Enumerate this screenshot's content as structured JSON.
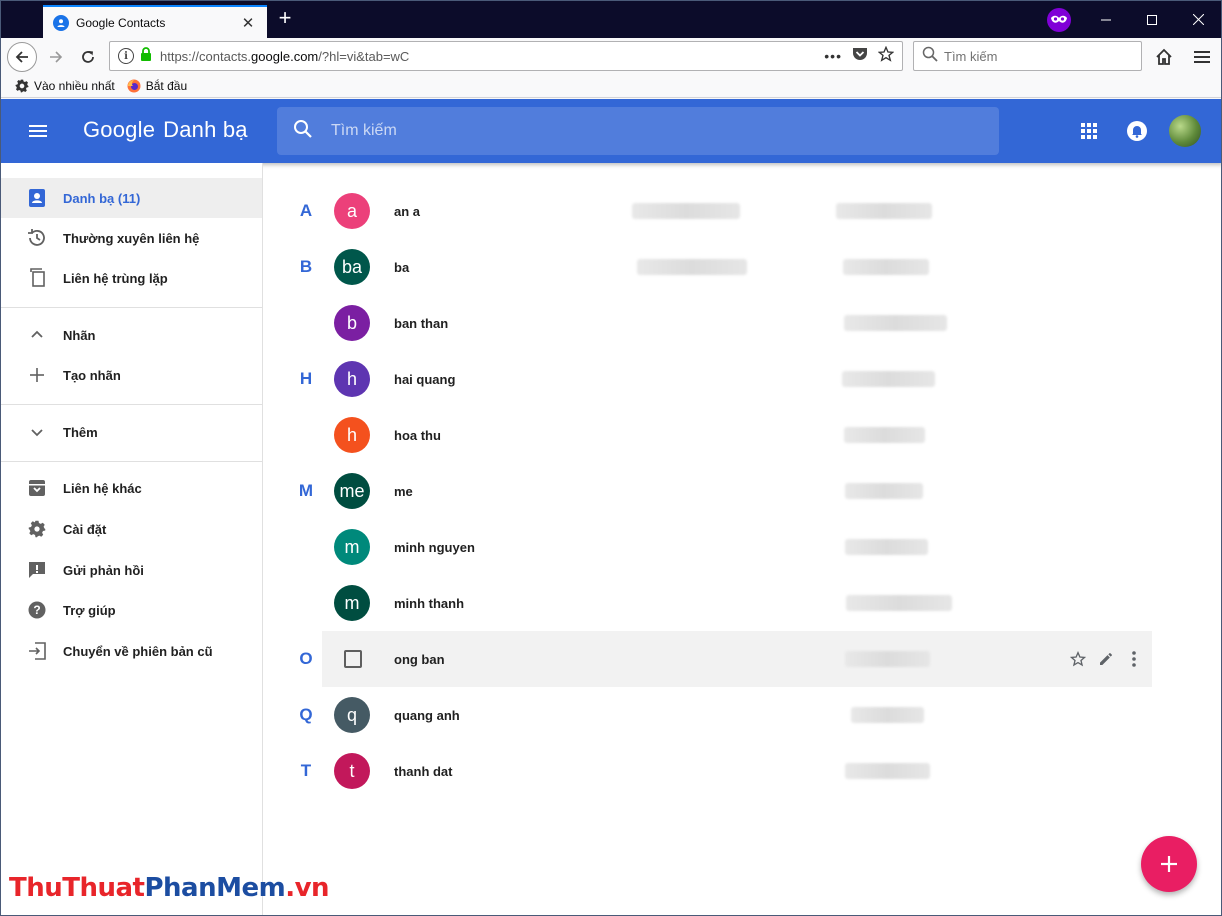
{
  "browser": {
    "tab_title": "Google Contacts",
    "url_prefix": "https://contacts.",
    "url_domain": "google.com",
    "url_suffix": "/?hl=vi&tab=wC",
    "search_placeholder": "Tìm kiếm",
    "bookmarks": [
      {
        "label": "Vào nhiều nhất",
        "icon": "gear-icon"
      },
      {
        "label": "Bắt đầu",
        "icon": "firefox-icon"
      }
    ]
  },
  "app": {
    "brand_google": "Google",
    "brand_product": "Danh bạ",
    "search_placeholder": "Tìm kiếm",
    "header_color": "#3367d6",
    "fab_color": "#e91e63"
  },
  "sidebar": {
    "items": [
      {
        "label": "Danh bạ (11)",
        "icon": "contacts-icon",
        "active": true
      },
      {
        "label": "Thường xuyên liên hệ",
        "icon": "history-icon"
      },
      {
        "label": "Liên hệ trùng lặp",
        "icon": "duplicate-icon"
      },
      {
        "label": "Nhãn",
        "icon": "chevron-up-icon"
      },
      {
        "label": "Tạo nhãn",
        "icon": "plus-icon"
      },
      {
        "label": "Thêm",
        "icon": "chevron-down-icon"
      },
      {
        "label": "Liên hệ khác",
        "icon": "archive-icon"
      },
      {
        "label": "Cài đặt",
        "icon": "gear-icon"
      },
      {
        "label": "Gửi phản hồi",
        "icon": "feedback-icon"
      },
      {
        "label": "Trợ giúp",
        "icon": "help-icon"
      },
      {
        "label": "Chuyển về phiên bản cũ",
        "icon": "exit-icon"
      }
    ]
  },
  "contacts": [
    {
      "letter": "A",
      "initial": "a",
      "name": "an a",
      "color": "#ec407a"
    },
    {
      "letter": "B",
      "initial": "ba",
      "name": "ba",
      "color": "#00574b"
    },
    {
      "letter": "",
      "initial": "b",
      "name": "ban than",
      "color": "#7b1fa2"
    },
    {
      "letter": "H",
      "initial": "h",
      "name": "hai quang",
      "color": "#5e35b1"
    },
    {
      "letter": "",
      "initial": "h",
      "name": "hoa thu",
      "color": "#f4511e"
    },
    {
      "letter": "M",
      "initial": "me",
      "name": "me",
      "color": "#004d40"
    },
    {
      "letter": "",
      "initial": "m",
      "name": "minh nguyen",
      "color": "#00897b"
    },
    {
      "letter": "",
      "initial": "m",
      "name": "minh thanh",
      "color": "#004d40"
    },
    {
      "letter": "O",
      "initial": "",
      "name": "ong ban",
      "color": "",
      "hover": true
    },
    {
      "letter": "Q",
      "initial": "q",
      "name": "quang anh",
      "color": "#455a64"
    },
    {
      "letter": "T",
      "initial": "t",
      "name": "thanh dat",
      "color": "#c2185b"
    }
  ],
  "watermark": {
    "part1": "ThuThuat",
    "part2": "PhanMem",
    "part3": ".vn"
  }
}
